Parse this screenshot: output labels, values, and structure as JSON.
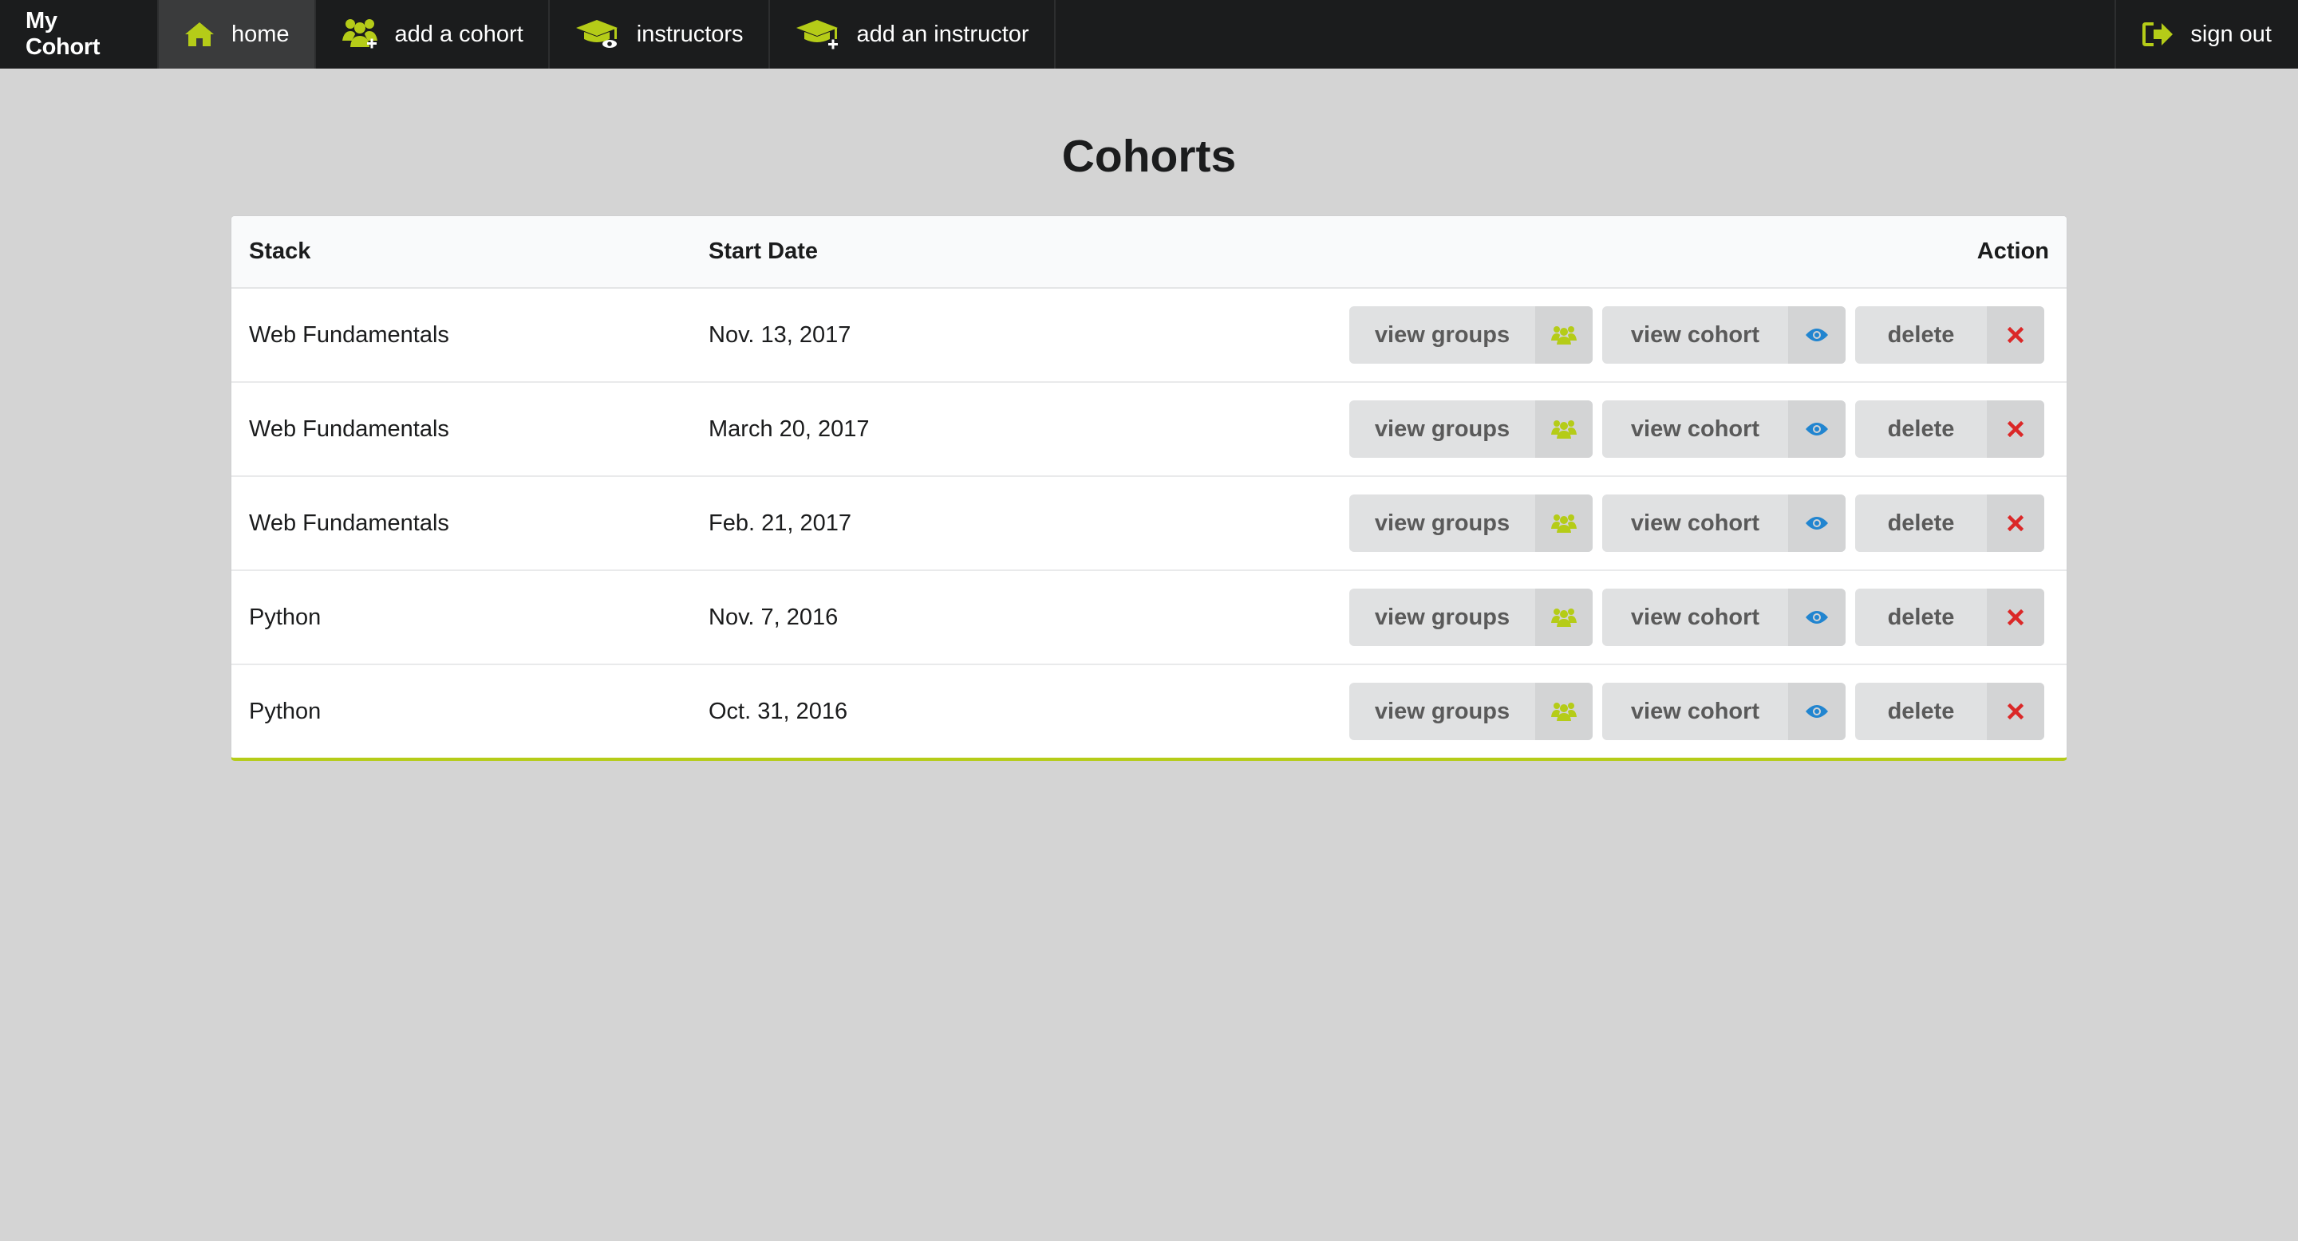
{
  "nav": {
    "brand": "My Cohort",
    "items": [
      {
        "label": "home",
        "icon": "home-icon",
        "active": true
      },
      {
        "label": "add a cohort",
        "icon": "add-users-icon"
      },
      {
        "label": "instructors",
        "icon": "graduation-cap-eye-icon"
      },
      {
        "label": "add an instructor",
        "icon": "graduation-cap-plus-icon"
      }
    ],
    "signout": {
      "label": "sign out",
      "icon": "sign-out-icon"
    }
  },
  "page": {
    "title": "Cohorts"
  },
  "table": {
    "headers": {
      "stack": "Stack",
      "start_date": "Start Date",
      "action": "Action"
    },
    "actions": {
      "groups": "view groups",
      "cohort": "view cohort",
      "delete": "delete"
    },
    "rows": [
      {
        "stack": "Web Fundamentals",
        "start_date": "Nov. 13, 2017"
      },
      {
        "stack": "Web Fundamentals",
        "start_date": "March 20, 2017"
      },
      {
        "stack": "Web Fundamentals",
        "start_date": "Feb. 21, 2017"
      },
      {
        "stack": "Python",
        "start_date": "Nov. 7, 2016"
      },
      {
        "stack": "Python",
        "start_date": "Oct. 31, 2016"
      }
    ]
  },
  "colors": {
    "accent": "#b5cc18",
    "eye": "#2185d0",
    "delete": "#db2828",
    "nav_bg": "#1b1c1d"
  }
}
